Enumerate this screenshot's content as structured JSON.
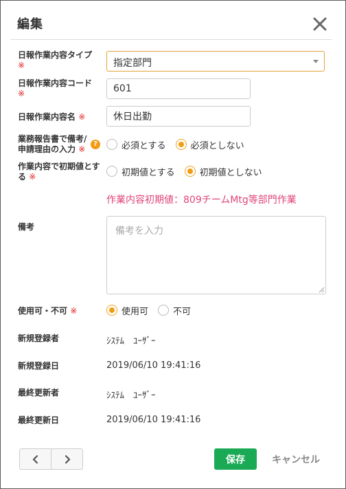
{
  "dialog": {
    "title": "編集",
    "close_icon": "close-icon"
  },
  "fields": {
    "type": {
      "label": "日報作業内容タイプ",
      "required_mark": "※",
      "value": "指定部門"
    },
    "code": {
      "label": "日報作業内容コード",
      "required_mark": "※",
      "value": "601"
    },
    "name": {
      "label": "日報作業内容名",
      "required_mark": "※",
      "value": "休日出勤"
    },
    "reason": {
      "label_line1": "業務報告書で備考/",
      "label_line2": "申請理由の入力",
      "required_mark": "※",
      "help_icon": "?",
      "options": [
        "必須とする",
        "必須としない"
      ],
      "selected": "必須としない"
    },
    "initial": {
      "label_line1": "作業内容で初期値とす",
      "label_line2": "る",
      "required_mark": "※",
      "options": [
        "初期値とする",
        "初期値としない"
      ],
      "selected": "初期値としない",
      "note": "作業内容初期値：809チームMtg等部門作業"
    },
    "remarks": {
      "label": "備考",
      "placeholder": "備考を入力",
      "value": ""
    },
    "availability": {
      "label": "使用可・不可",
      "required_mark": "※",
      "options": [
        "使用可",
        "不可"
      ],
      "selected": "使用可"
    },
    "created_by": {
      "label": "新規登録者",
      "value": "ｼｽﾃﾑ　ﾕｰｻﾞｰ"
    },
    "created_at": {
      "label": "新規登録日",
      "value": "2019/06/10 19:41:16"
    },
    "updated_by": {
      "label": "最終更新者",
      "value": "ｼｽﾃﾑ　ﾕｰｻﾞｰ"
    },
    "updated_at": {
      "label": "最終更新日",
      "value": "2019/06/10 19:41:16"
    }
  },
  "footer": {
    "prev_icon": "chevron-left-icon",
    "next_icon": "chevron-right-icon",
    "save_label": "保存",
    "cancel_label": "キャンセル"
  },
  "colors": {
    "accent": "#f39c12",
    "required": "#e02020",
    "note": "#e0457b",
    "save": "#1aaa55"
  }
}
